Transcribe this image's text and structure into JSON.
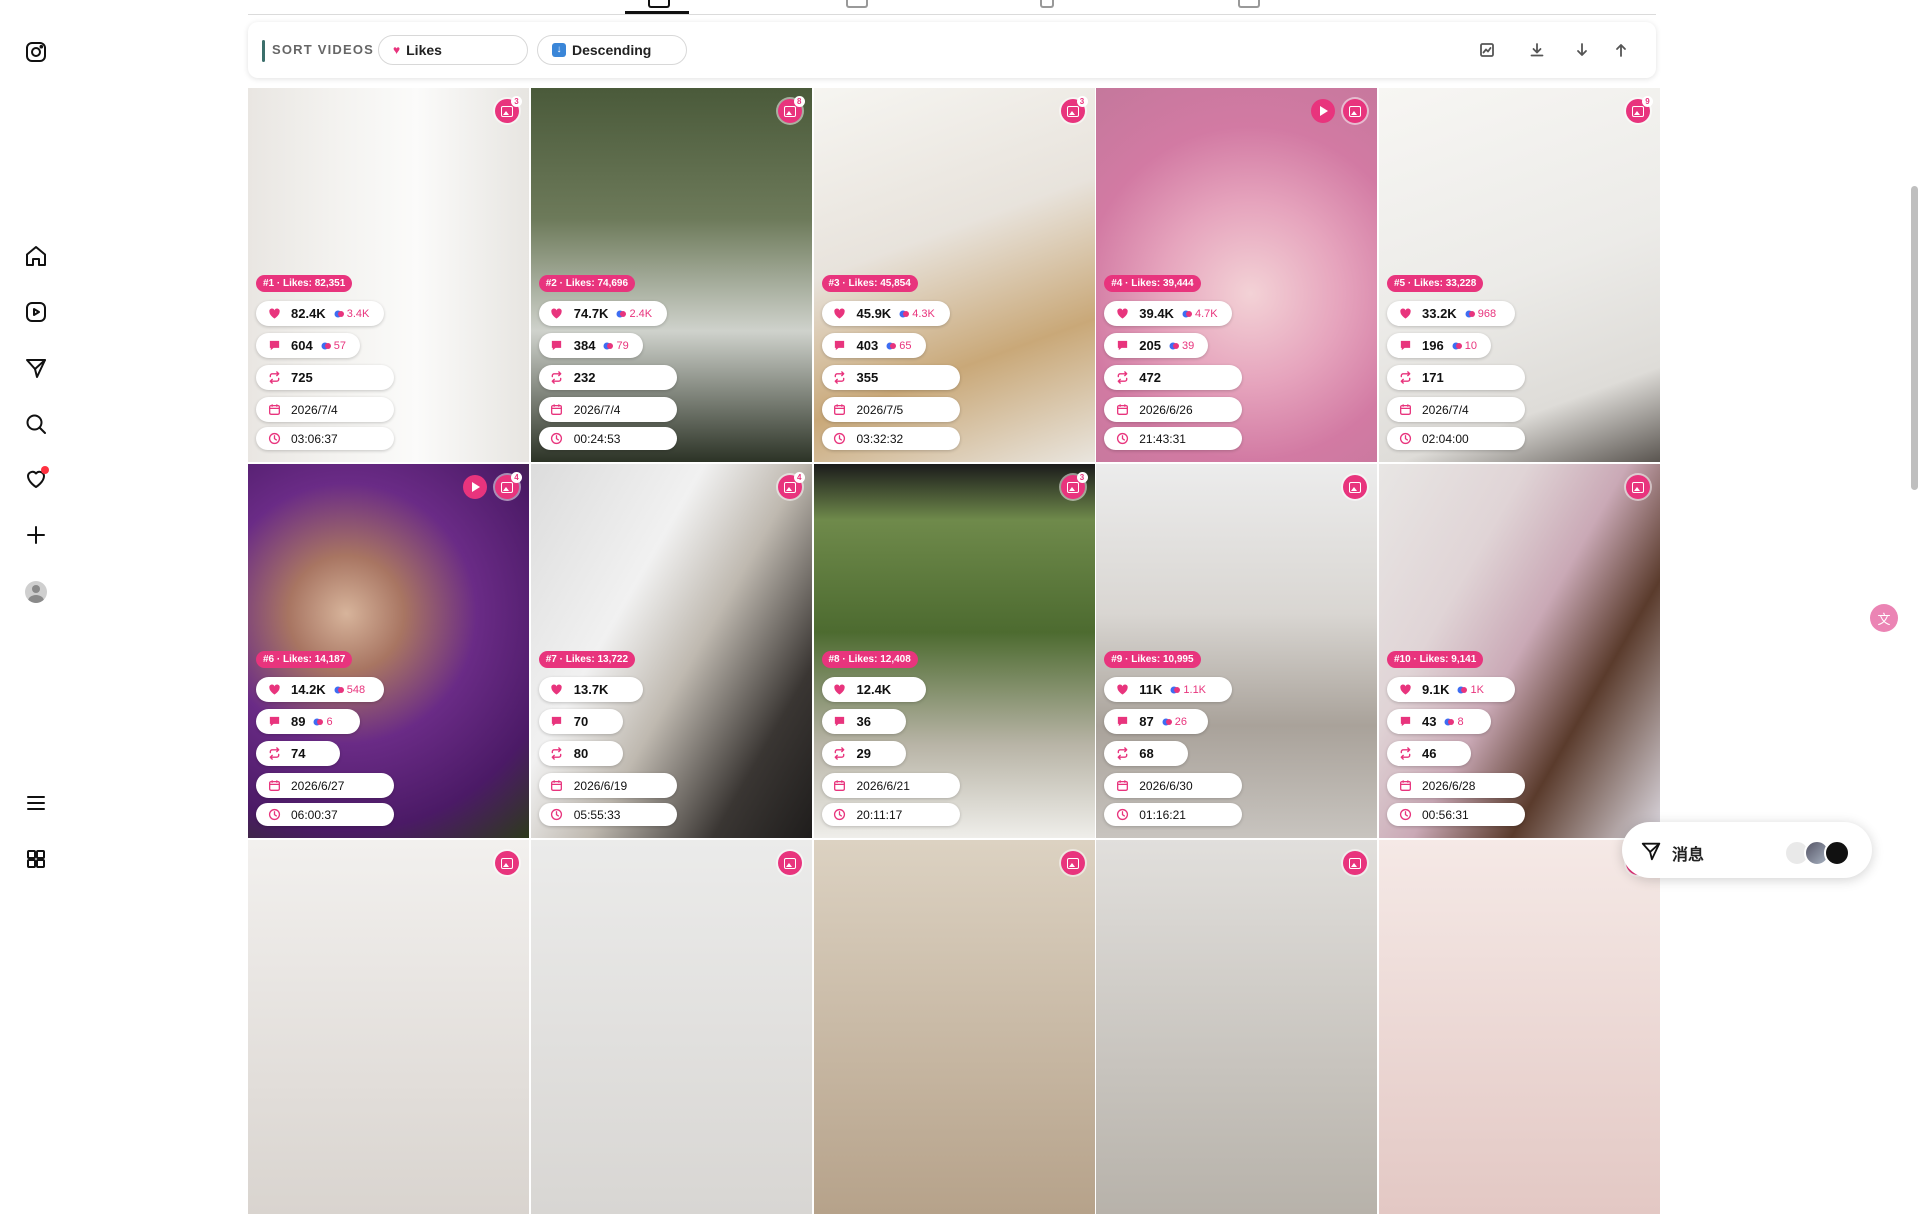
{
  "sort_bar": {
    "title": "SORT VIDEOS",
    "sort_by": {
      "icon": "heart-emoji",
      "label": "Likes"
    },
    "order": {
      "icon": "down-arrow-emoji",
      "label": "Descending"
    },
    "tools": [
      "chart-icon",
      "download-icon",
      "arrow-down-icon",
      "arrow-up-icon"
    ]
  },
  "messages": {
    "label": "消息"
  },
  "translate": {
    "label": "文"
  },
  "colors": {
    "accent": "#e8347d",
    "bar_accent": "#3b6f6b"
  },
  "posts": [
    {
      "rank": "#1 · Likes: 82,351",
      "likes": "82.4K",
      "likes_sub": "3.4K",
      "comments": "604",
      "comments_sub": "57",
      "shares": "725",
      "date": "2026/7/4",
      "duration": "03:06:37",
      "count": "3",
      "video": false
    },
    {
      "rank": "#2 · Likes: 74,696",
      "likes": "74.7K",
      "likes_sub": "2.4K",
      "comments": "384",
      "comments_sub": "79",
      "shares": "232",
      "date": "2026/7/4",
      "duration": "00:24:53",
      "count": "8",
      "video": false
    },
    {
      "rank": "#3 · Likes: 45,854",
      "likes": "45.9K",
      "likes_sub": "4.3K",
      "comments": "403",
      "comments_sub": "65",
      "shares": "355",
      "date": "2026/7/5",
      "duration": "03:32:32",
      "count": "3",
      "video": false
    },
    {
      "rank": "#4 · Likes: 39,444",
      "likes": "39.4K",
      "likes_sub": "4.7K",
      "comments": "205",
      "comments_sub": "39",
      "shares": "472",
      "date": "2026/6/26",
      "duration": "21:43:31",
      "count": "",
      "video": true
    },
    {
      "rank": "#5 · Likes: 33,228",
      "likes": "33.2K",
      "likes_sub": "968",
      "comments": "196",
      "comments_sub": "10",
      "shares": "171",
      "date": "2026/7/4",
      "duration": "02:04:00",
      "count": "9",
      "video": false
    },
    {
      "rank": "#6 · Likes: 14,187",
      "likes": "14.2K",
      "likes_sub": "548",
      "comments": "89",
      "comments_sub": "6",
      "shares": "74",
      "date": "2026/6/27",
      "duration": "06:00:37",
      "count": "4",
      "video": true
    },
    {
      "rank": "#7 · Likes: 13,722",
      "likes": "13.7K",
      "likes_sub": "",
      "comments": "70",
      "comments_sub": "",
      "shares": "80",
      "date": "2026/6/19",
      "duration": "05:55:33",
      "count": "4",
      "video": false
    },
    {
      "rank": "#8 · Likes: 12,408",
      "likes": "12.4K",
      "likes_sub": "",
      "comments": "36",
      "comments_sub": "",
      "shares": "29",
      "date": "2026/6/21",
      "duration": "20:11:17",
      "count": "3",
      "video": false
    },
    {
      "rank": "#9 · Likes: 10,995",
      "likes": "11K",
      "likes_sub": "1.1K",
      "comments": "87",
      "comments_sub": "26",
      "shares": "68",
      "date": "2026/6/30",
      "duration": "01:16:21",
      "count": "",
      "video": false
    },
    {
      "rank": "#10 · Likes: 9,141",
      "likes": "9.1K",
      "likes_sub": "1K",
      "comments": "43",
      "comments_sub": "8",
      "shares": "46",
      "date": "2026/6/28",
      "duration": "00:56:31",
      "count": "",
      "video": false
    },
    {
      "count": "",
      "video": false
    },
    {
      "count": "",
      "video": false
    },
    {
      "count": "",
      "video": false
    },
    {
      "count": "",
      "video": false
    },
    {
      "count": "",
      "video": false
    }
  ]
}
